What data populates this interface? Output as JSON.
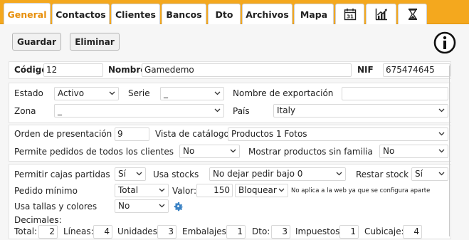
{
  "tabs": [
    {
      "label": "General",
      "active": true
    },
    {
      "label": "Contactos"
    },
    {
      "label": "Clientes"
    },
    {
      "label": "Bancos"
    },
    {
      "label": "Dto"
    },
    {
      "label": "Archivos"
    },
    {
      "label": "Mapa"
    },
    {
      "icon": "calendar-icon",
      "calendar_day": "31"
    },
    {
      "icon": "chart-icon"
    },
    {
      "icon": "hourglass-icon"
    }
  ],
  "toolbar": {
    "save_label": "Guardar",
    "delete_label": "Eliminar",
    "info_icon": "info-icon"
  },
  "header": {
    "codigo_label": "Código",
    "codigo_value": "12",
    "nombre_label": "Nombre",
    "nombre_value": "Gamedemo",
    "nif_label": "NIF",
    "nif_value": "675474645"
  },
  "row_estado": {
    "estado_label": "Estado",
    "estado_value": "Activo",
    "serie_label": "Serie",
    "serie_value": "_",
    "export_label": "Nombre de exportación",
    "export_value": ""
  },
  "row_zona": {
    "zona_label": "Zona",
    "zona_value": "_",
    "pais_label": "País",
    "pais_value": "Italy"
  },
  "catalog": {
    "orden_label": "Orden de presentación",
    "orden_value": "9",
    "vista_label": "Vista de catálogo",
    "vista_value": "Productos 1 Fotos",
    "permite_label": "Permite pedidos de todos los clientes",
    "permite_value": "No",
    "mostrar_label": "Mostrar productos sin familia",
    "mostrar_value": "No"
  },
  "orders": {
    "cajas_label": "Permitir cajas partidas",
    "cajas_value": "Sí",
    "stocks_label": "Usa stocks",
    "stocks_value": "No dejar pedir bajo 0",
    "restar_label": "Restar stock",
    "restar_value": "Sí",
    "pedido_label": "Pedido mínimo",
    "pedido_value": "Total",
    "valor_label": "Valor:",
    "valor_value": "150",
    "bloquear_value": "Bloquear",
    "note": "No aplica a la web ya que se configura aparte",
    "tallas_label": "Usa tallas y colores",
    "tallas_value": "No",
    "gear_icon": "gear-icon"
  },
  "decimals": {
    "title": "Decimales:",
    "items": [
      {
        "label": "Total:",
        "value": "2"
      },
      {
        "label": "Líneas:",
        "value": "4"
      },
      {
        "label": "Unidades:",
        "value": "3"
      },
      {
        "label": "Embalajes:",
        "value": "1"
      },
      {
        "label": "Dto:",
        "value": "3"
      },
      {
        "label": "Impuestos:",
        "value": "1"
      },
      {
        "label": "Cubicaje:",
        "value": "4"
      }
    ]
  },
  "colors": {
    "accent": "#f4a81e",
    "active_tab_text": "#e78f0a",
    "gear": "#3b82c4"
  }
}
